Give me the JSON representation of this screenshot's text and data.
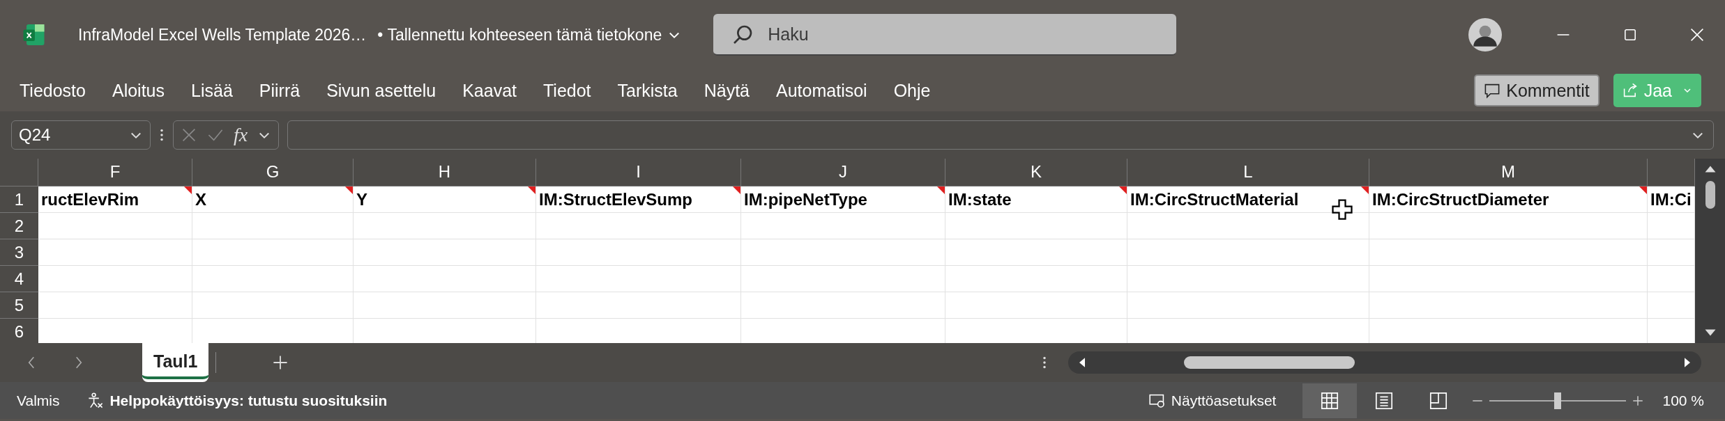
{
  "window": {
    "file_name": "InfraModel Excel Wells Template 2026…",
    "save_status": "• Tallennettu kohteeseen tämä tietokone"
  },
  "search": {
    "placeholder": "Haku"
  },
  "menu": [
    "Tiedosto",
    "Aloitus",
    "Lisää",
    "Piirrä",
    "Sivun asettelu",
    "Kaavat",
    "Tiedot",
    "Tarkista",
    "Näytä",
    "Automatisoi",
    "Ohje"
  ],
  "buttons": {
    "comments": "Kommentit",
    "share": "Jaa"
  },
  "formula_bar": {
    "name_box": "Q24",
    "function_label": "fx"
  },
  "columns": [
    "F",
    "G",
    "H",
    "I",
    "J",
    "K",
    "L",
    "M",
    ""
  ],
  "rows": [
    {
      "number": "1",
      "cells": [
        {
          "text": "ructElevRim",
          "comment": true
        },
        {
          "text": "X",
          "comment": true
        },
        {
          "text": "Y",
          "comment": true
        },
        {
          "text": "IM:StructElevSump",
          "comment": true
        },
        {
          "text": "IM:pipeNetType",
          "comment": true
        },
        {
          "text": "IM:state",
          "comment": true
        },
        {
          "text": "IM:CircStructMaterial",
          "comment": true
        },
        {
          "text": "IM:CircStructDiameter",
          "comment": true
        },
        {
          "text": "IM:Ci",
          "comment": false
        }
      ]
    },
    {
      "number": "2"
    },
    {
      "number": "3"
    },
    {
      "number": "4"
    },
    {
      "number": "5"
    },
    {
      "number": "6"
    }
  ],
  "sheet_tabs": [
    {
      "label": "Taul1",
      "selected": true
    }
  ],
  "status_bar": {
    "status": "Valmis",
    "accessibility": "Helppokäyttöisyys: tutustu suosituksiin",
    "display_settings": "Näyttöasetukset",
    "views": [
      {
        "kind": "normal",
        "selected": true
      },
      {
        "kind": "page_layout",
        "selected": false
      },
      {
        "kind": "page_break",
        "selected": false
      }
    ],
    "zoom": {
      "level": 0.5,
      "reading": "100 %"
    }
  }
}
